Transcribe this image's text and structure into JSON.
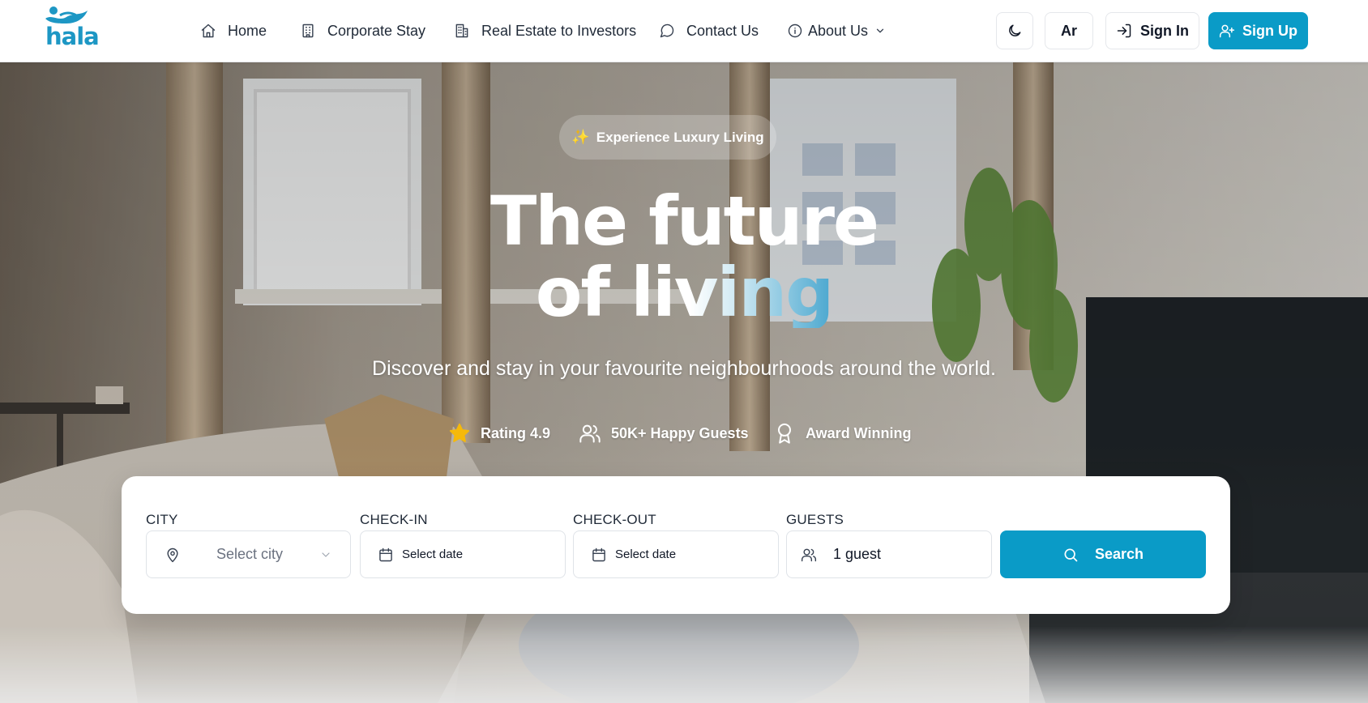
{
  "brand": {
    "logo_text": "hala",
    "brand_color": "#1d97c4"
  },
  "nav": {
    "items": [
      {
        "label": "Home",
        "icon": "home-icon"
      },
      {
        "label": "Corporate Stay",
        "icon": "building-icon"
      },
      {
        "label": "Real Estate to Investors",
        "icon": "office-building-icon"
      },
      {
        "label": "Contact Us",
        "icon": "message-circle-icon"
      },
      {
        "label": "About Us",
        "icon": "info-icon"
      }
    ],
    "theme_toggle_icon": "moon-icon",
    "language_label": "Ar",
    "signin_label": "Sign In",
    "signup_label": "Sign Up",
    "accent_color": "#0a9bc7"
  },
  "hero": {
    "badge": "Experience Luxury Living",
    "headline_line1": "The future",
    "headline_line2": "of living",
    "subtitle": "Discover and stay in your favourite neighbourhoods around the world.",
    "stats": [
      {
        "label": "Rating 4.9",
        "icon": "star-icon"
      },
      {
        "label": "50K+ Happy Guests",
        "icon": "users-icon"
      },
      {
        "label": "Award Winning",
        "icon": "award-icon"
      }
    ]
  },
  "search": {
    "city_label": "CITY",
    "city_placeholder": "Select city",
    "checkin_label": "CHECK-IN",
    "checkin_value": "Select date",
    "checkout_label": "CHECK-OUT",
    "checkout_value": "Select date",
    "guests_label": "GUESTS",
    "guests_value": "1 guest",
    "button_label": "Search"
  }
}
